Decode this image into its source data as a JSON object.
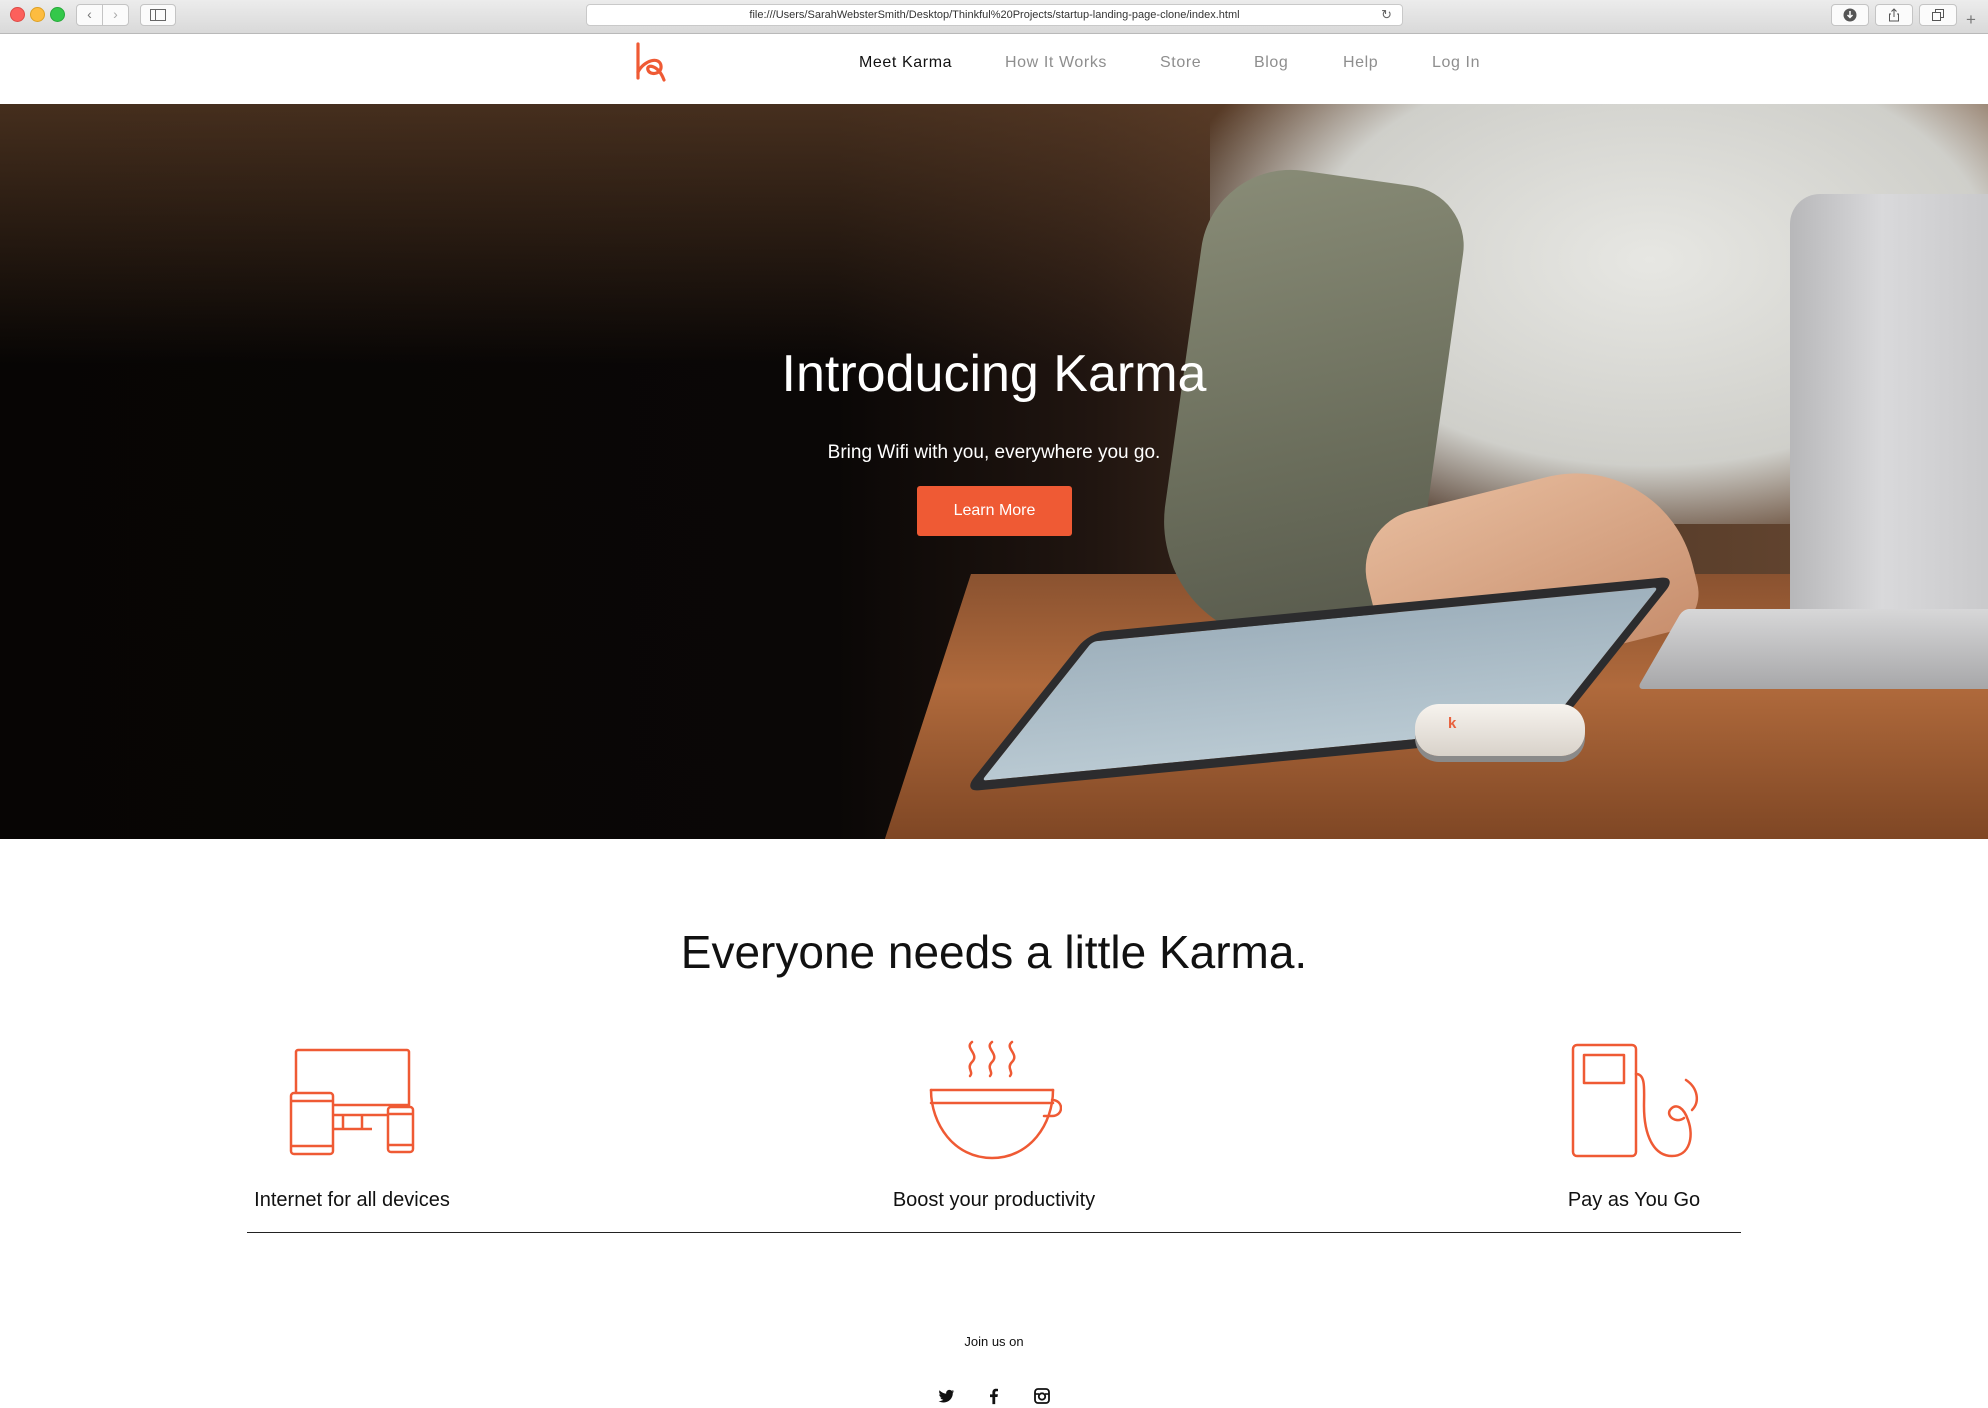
{
  "browser": {
    "url": "file:///Users/SarahWebsterSmith/Desktop/Thinkful%20Projects/startup-landing-page-clone/index.html",
    "icons": [
      "back-icon",
      "forward-icon",
      "sidebar-icon",
      "reload-icon",
      "download-icon",
      "share-icon",
      "tabs-icon",
      "new-tab-icon"
    ]
  },
  "header": {
    "nav": [
      {
        "label": "Meet Karma",
        "active": true
      },
      {
        "label": "How It Works",
        "active": false
      },
      {
        "label": "Store",
        "active": false
      },
      {
        "label": "Blog",
        "active": false
      },
      {
        "label": "Help",
        "active": false
      },
      {
        "label": "Log In",
        "active": false
      }
    ]
  },
  "hero": {
    "title": "Introducing Karma",
    "subtitle": "Bring Wifi with you, everywhere you go.",
    "cta": "Learn More"
  },
  "features": {
    "title": "Everyone needs a little Karma.",
    "items": [
      {
        "label": "Internet for all devices",
        "icon": "devices-icon"
      },
      {
        "label": "Boost your productivity",
        "icon": "coffee-cup-icon"
      },
      {
        "label": "Pay as You Go",
        "icon": "fuel-pump-icon"
      }
    ]
  },
  "footer": {
    "join": "Join us on",
    "social": [
      "twitter-icon",
      "facebook-icon",
      "instagram-icon"
    ]
  },
  "colors": {
    "accent": "#ef5a34",
    "text": "#111111",
    "nav_inactive": "#8e8e8e"
  }
}
